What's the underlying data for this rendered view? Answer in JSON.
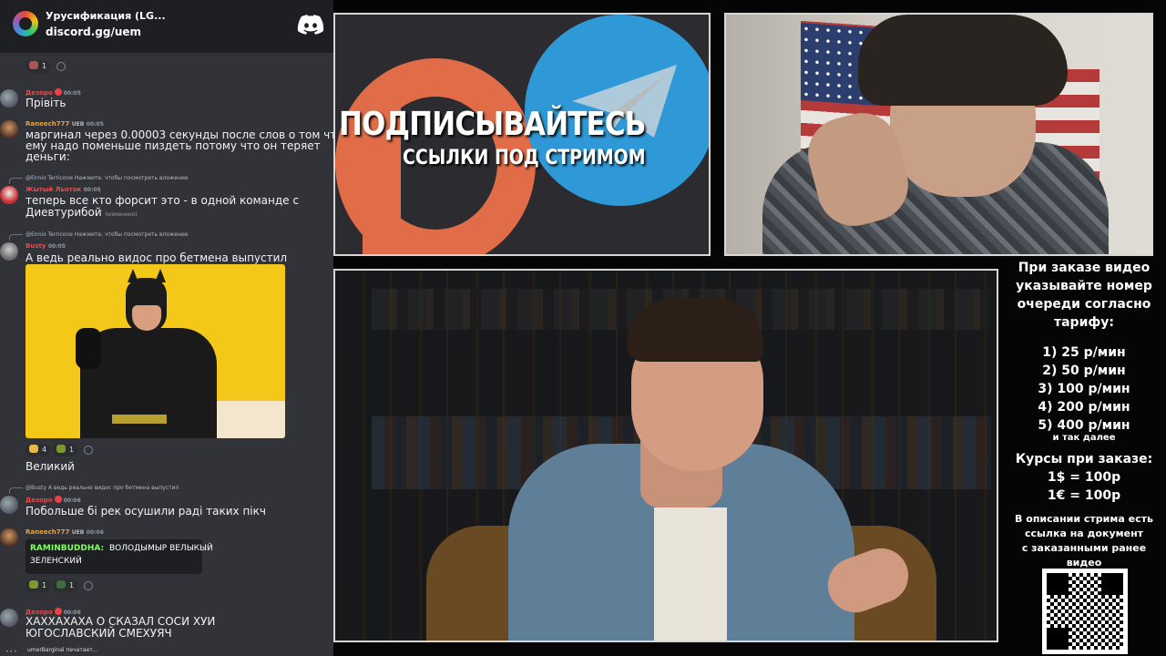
{
  "chat": {
    "server_name": "Урусификация (LG...",
    "server_link": "discord.gg/uem",
    "top_reaction_count": "1",
    "messages": [
      {
        "user": "Дезоро",
        "time": "00:05",
        "text": "Прівіть",
        "color": "#f04747"
      },
      {
        "user": "Raneech777",
        "tags": "UEB",
        "time": "00:05",
        "text_line1": "маргинал через 0.00003 секунды после слов о том что",
        "text_line2": "ему надо поменьше пиздеть потому что он теряет",
        "text_line3": "деньги:",
        "color": "#f0a030"
      },
      {
        "reply": "@Ennio Terricone  Нажмите, чтобы посмотреть вложение",
        "user": "Жытый Льоток",
        "time": "00:05",
        "text_line1": "теперь все кто форсит это - в одной команде с",
        "text_line2": "Диевтурибой",
        "edited": "(изменено)",
        "color": "#e85050"
      },
      {
        "reply": "@Ennio Terricone  Нажмите, чтобы посмотреть вложение",
        "user": "Busty",
        "time": "00:05",
        "text": "А ведь реально видос про бетмена выпустил",
        "color": "#f04747"
      }
    ],
    "batman_reactions": [
      {
        "count": "4"
      },
      {
        "count": "1"
      }
    ],
    "msg_great": "Великий",
    "reply_busty": "@Busty  А ведь реально видос про бетмена выпустил",
    "msg5": {
      "user": "Дезоро",
      "time": "00:06",
      "text": "Побольше бі рек осушили раді таких пікч"
    },
    "msg6": {
      "user": "Raneech777",
      "tags": "UEB",
      "time": "00:06"
    },
    "mention": {
      "name": "RAMINBUDDHA:",
      "text1": "ВОЛОДЫМЫР ВЕЛЫКЫЙ",
      "text2": "ЗЕЛЕНСКИЙ"
    },
    "mention_reactions": [
      {
        "count": "1"
      },
      {
        "count": "1"
      }
    ],
    "msg7": {
      "user": "Дезоро",
      "time": "00:06",
      "text_line1": "ХАХХАХАХА О СКАЗАЛ СОСИ ХУИ",
      "text_line2": "ЮГОСЛАВСКИЙ СМЕХУЯЧ"
    },
    "typing": "umerBarginal печатает..."
  },
  "promo": {
    "title": "ПОДПИСЫВАЙТЕСЬ",
    "subtitle": "ССЫЛКИ ПОД СТРИМОМ"
  },
  "info": {
    "order_line1": "При заказе видео",
    "order_line2": "указывайте номер",
    "order_line3": "очереди согласно",
    "order_line4": "тарифу:",
    "tariffs": [
      "1) 25 р/мин",
      "2) 50 р/мин",
      "3) 100 р/мин",
      "4) 200 р/мин",
      "5) 400 р/мин"
    ],
    "tariff_note": "и так далее",
    "rates_title": "Курсы при заказе:",
    "rate_usd": "1$ = 100р",
    "rate_eur": "1€ = 100р",
    "desc_line1": "В описании стрима есть",
    "desc_line2": "ссылка на документ",
    "desc_line3": "с заказанными ранее",
    "desc_line4": "видео"
  },
  "colors": {
    "discord_bg": "#313338",
    "telegram": "#2f98d6",
    "patreon": "#e06c48",
    "username_red": "#f04747",
    "username_orange": "#f0a030",
    "mention_green": "#80ff60"
  }
}
